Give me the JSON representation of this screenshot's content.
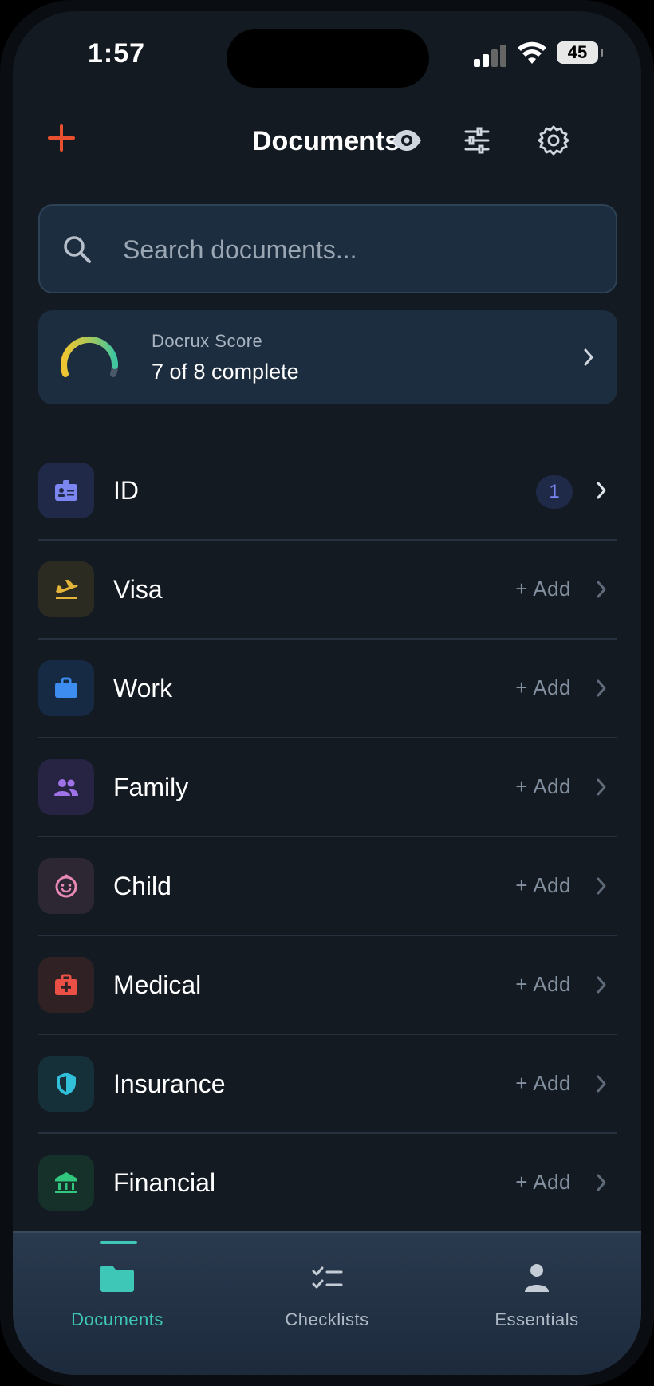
{
  "status": {
    "time": "1:57",
    "battery": "45"
  },
  "header": {
    "title": "Documents"
  },
  "search": {
    "placeholder": "Search documents..."
  },
  "score": {
    "label": "Docrux Score",
    "value": "7 of 8 complete",
    "completed": 7,
    "total": 8
  },
  "categories": [
    {
      "label": "ID",
      "badge": "1",
      "icon": "id-badge-icon",
      "color": "#7b86f0"
    },
    {
      "label": "Visa",
      "add": "+ Add",
      "icon": "plane-departure-icon",
      "color": "#e2b53a"
    },
    {
      "label": "Work",
      "add": "+ Add",
      "icon": "briefcase-icon",
      "color": "#3d8df0"
    },
    {
      "label": "Family",
      "add": "+ Add",
      "icon": "people-icon",
      "color": "#a072e8"
    },
    {
      "label": "Child",
      "add": "+ Add",
      "icon": "baby-face-icon",
      "color": "#e889b6"
    },
    {
      "label": "Medical",
      "add": "+ Add",
      "icon": "medical-kit-icon",
      "color": "#ea5045"
    },
    {
      "label": "Insurance",
      "add": "+ Add",
      "icon": "shield-icon",
      "color": "#31bfd9"
    },
    {
      "label": "Financial",
      "add": "+ Add",
      "icon": "bank-icon",
      "color": "#31c77f"
    }
  ],
  "tabs": [
    {
      "label": "Documents",
      "icon": "folder-icon",
      "active": true
    },
    {
      "label": "Checklists",
      "icon": "checklist-icon",
      "active": false
    },
    {
      "label": "Essentials",
      "icon": "person-icon",
      "active": false
    }
  ],
  "colors": {
    "accent": "#e8502f",
    "teal": "#3ec7b6",
    "background": "#131a22",
    "card": "#1d2d40"
  }
}
